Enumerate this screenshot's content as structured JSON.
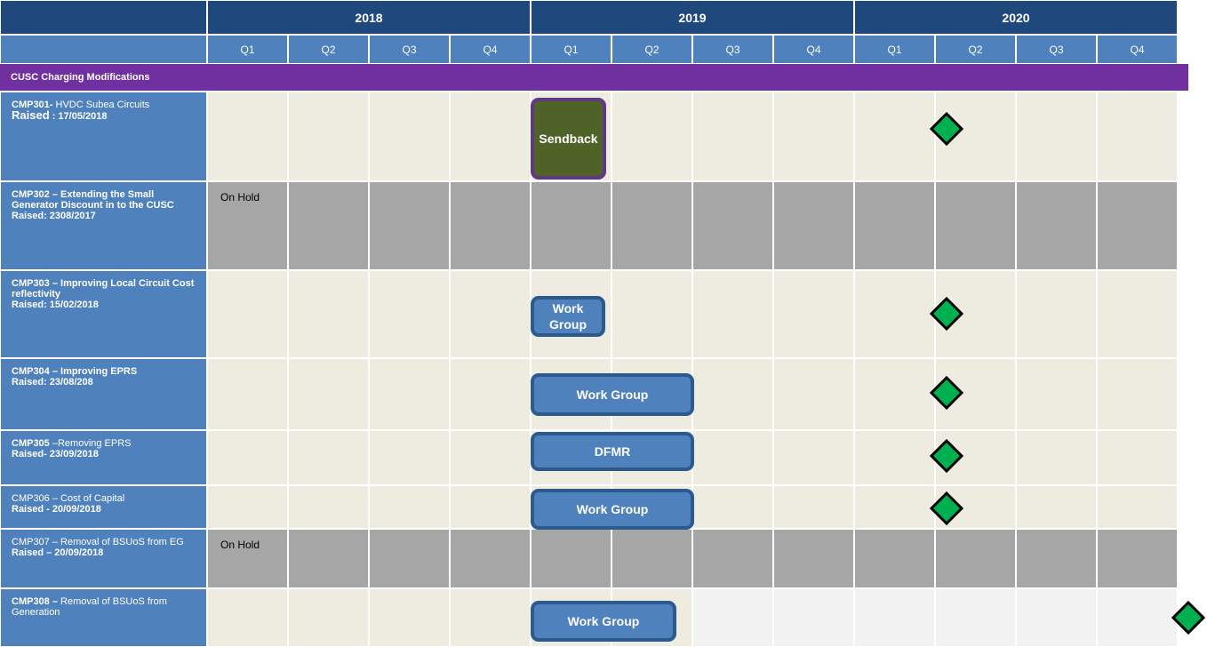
{
  "years": [
    "2018",
    "2019",
    "2020"
  ],
  "quarters": [
    "Q1",
    "Q2",
    "Q3",
    "Q4",
    "Q1",
    "Q2",
    "Q3",
    "Q4",
    "Q1",
    "Q2",
    "Q3",
    "Q4"
  ],
  "section_title": "CUSC Charging Modifications",
  "rows": [
    {
      "code": "CMP301-",
      "title": "HVDC Subea Circuits",
      "raised_label": "Raised",
      "raised_date": ": 17/05/2018"
    },
    {
      "code": "CMP302 – Extending the Small Generator Discount in to the CUSC",
      "raised": "Raised: 2308/2017",
      "status": "On Hold"
    },
    {
      "code": "CMP303 – Improving Local Circuit Cost reflectivity",
      "raised": "Raised: 15/02/2018"
    },
    {
      "code": "CMP304 – Improving EPRS",
      "raised": "Raised: 23/08/208"
    },
    {
      "code": "CMP305",
      "title": "–Removing EPRS",
      "raised": "Raised- 23/09/2018"
    },
    {
      "title": "CMP306 – Cost of Capital",
      "raised": "Raised -  20/09/2018"
    },
    {
      "title": "CMP307 – Removal of BSUoS from EG",
      "raised": "Raised – 20/09/2018",
      "status": "On Hold"
    },
    {
      "code": "CMP308 –",
      "title": "Removal of BSUoS from Generation"
    }
  ],
  "bars": {
    "cmp301": "Sendback",
    "cmp303": "Work Group",
    "cmp304": "Work Group",
    "cmp305": "DFMR",
    "cmp306": "Work Group",
    "cmp308": "Work Group"
  },
  "colors": {
    "year_header": "#1f497d",
    "quarter_header": "#4f81bd",
    "section": "#7030a0",
    "light_cell": "#eeece1",
    "on_hold_cell": "#a6a6a6",
    "bar": "#4f81bd",
    "sendback": "#4f6228",
    "milestone": "#00b050"
  },
  "milestone_icon": "diamond"
}
